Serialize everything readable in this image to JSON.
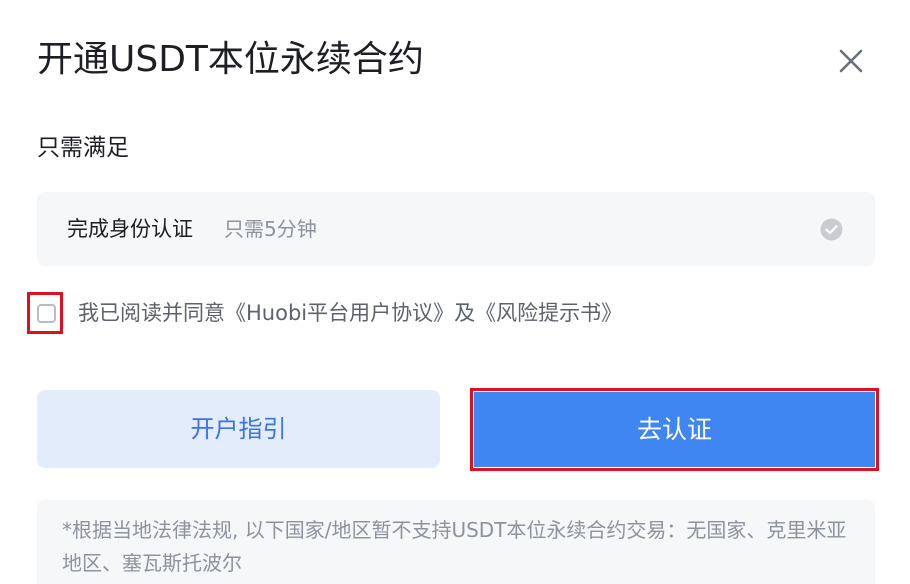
{
  "dialog": {
    "title": "开通USDT本位永续合约",
    "close_icon": "close-icon"
  },
  "requirements": {
    "heading": "只需满足",
    "item": {
      "label": "完成身份认证",
      "hint": "只需5分钟",
      "status_icon": "check-circle-icon",
      "completed": false
    }
  },
  "agreement": {
    "checked": false,
    "text": "我已阅读并同意《Huobi平台用户协议》及《风险提示书》"
  },
  "buttons": {
    "guide_label": "开户指引",
    "verify_label": "去认证"
  },
  "notice": {
    "text": "*根据当地法律法规, 以下国家/地区暂不支持USDT本位永续合约交易：无国家、克里米亚地区、塞瓦斯托波尔"
  },
  "colors": {
    "primary": "#3f86f3",
    "primary_light": "#e2ecfb",
    "highlight": "#e0101f",
    "muted_text": "#8d939e",
    "panel_bg": "#f6f7f9"
  }
}
